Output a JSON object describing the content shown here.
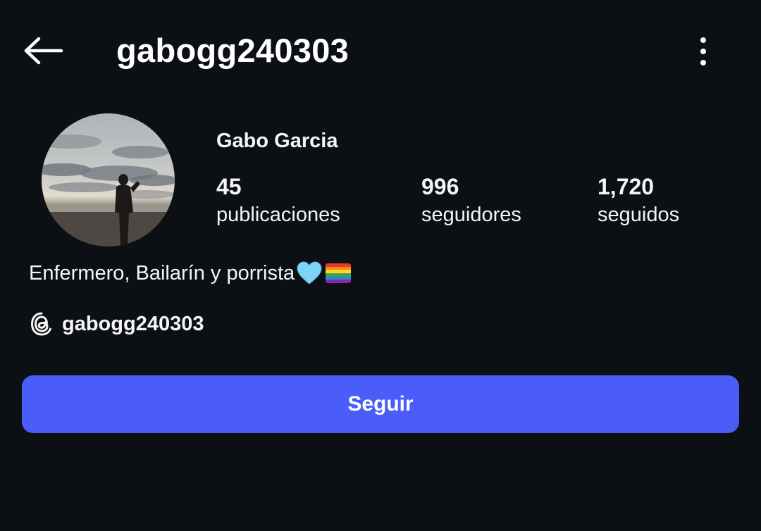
{
  "header": {
    "username": "gabogg240303",
    "back_icon": "arrow-left-icon",
    "more_icon": "more-vertical-icon"
  },
  "profile": {
    "full_name": "Gabo Garcia",
    "stats": [
      {
        "count": "45",
        "label": "publicaciones"
      },
      {
        "count": "996",
        "label": "seguidores"
      },
      {
        "count": "1,720",
        "label": "seguidos"
      }
    ],
    "bio": "Enfermero, Bailarín y porrista",
    "bio_emojis": [
      "light-blue-heart",
      "rainbow-flag"
    ],
    "threads_handle": "gabogg240303",
    "threads_icon": "threads-icon"
  },
  "actions": {
    "follow_label": "Seguir"
  },
  "colors": {
    "background": "#0c1014",
    "text": "#f5f5f5",
    "follow_button": "#4a5df9",
    "heart": "#7fd4f5"
  }
}
